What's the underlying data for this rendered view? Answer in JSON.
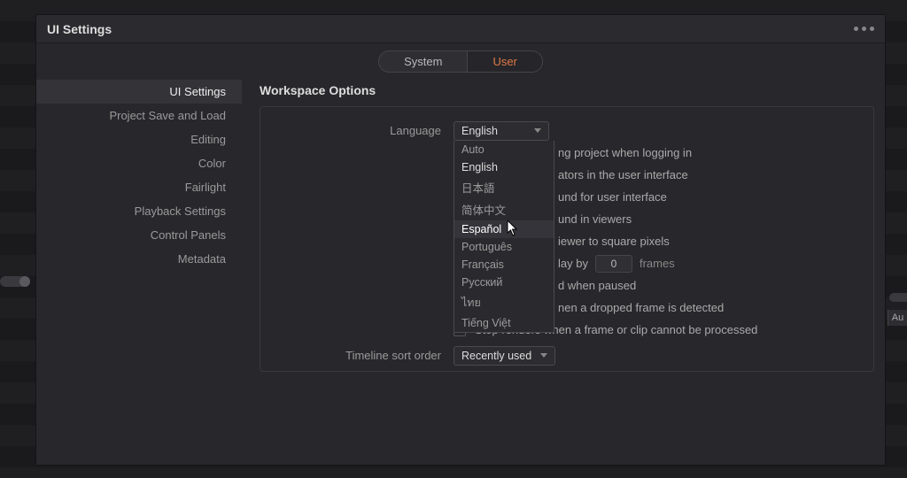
{
  "window": {
    "title": "UI Settings"
  },
  "tabs": {
    "system": "System",
    "user": "User"
  },
  "sidebar": {
    "items": [
      {
        "label": "UI Settings"
      },
      {
        "label": "Project Save and Load"
      },
      {
        "label": "Editing"
      },
      {
        "label": "Color"
      },
      {
        "label": "Fairlight"
      },
      {
        "label": "Playback Settings"
      },
      {
        "label": "Control Panels"
      },
      {
        "label": "Metadata"
      }
    ]
  },
  "main": {
    "section_title": "Workspace Options",
    "language_label": "Language",
    "language_value": "English",
    "language_options": [
      "Auto",
      "English",
      "日本語",
      "简体中文",
      "Español",
      "Português",
      "Français",
      "Русский",
      "ไทย",
      "Tiếng Việt"
    ],
    "checks": [
      {
        "text": "ng project when logging in"
      },
      {
        "text": "ators in the user interface"
      },
      {
        "text": "und for user interface"
      },
      {
        "text": "und in viewers"
      },
      {
        "text": "iewer to square pixels"
      }
    ],
    "delay": {
      "prefix": "lay by",
      "value": "0",
      "unit": "frames"
    },
    "paused_text": "d when paused",
    "dropped_text": "nen a dropped frame is detected",
    "stop_renders": "Stop renders when a frame or clip cannot be processed",
    "timeline_sort_label": "Timeline sort order",
    "timeline_sort_value": "Recently used"
  },
  "bg": {
    "right_button": "Au"
  }
}
